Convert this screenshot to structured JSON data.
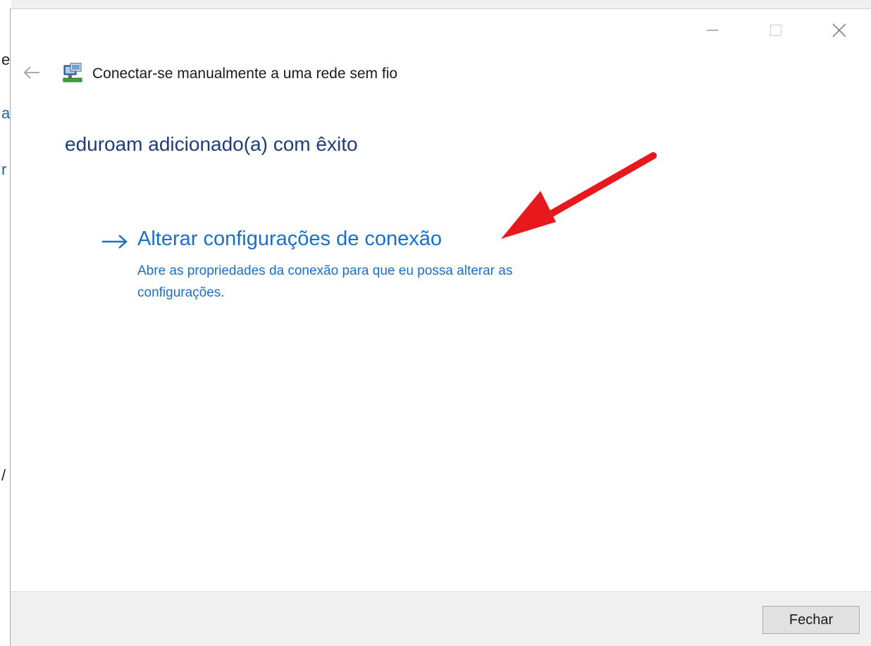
{
  "background_window": {
    "fragments": [
      "e",
      "a",
      "r",
      "/"
    ]
  },
  "window": {
    "caption_controls": {
      "minimize_icon": "minimize-icon",
      "maximize_icon": "maximize-icon",
      "close_icon": "close-icon"
    },
    "back_icon": "back-arrow-icon",
    "network_icon": "network-adapter-icon",
    "title": "Conectar-se manualmente a uma rede sem fio"
  },
  "main": {
    "success_heading": "eduroam adicionado(a) com êxito",
    "command_link": {
      "icon": "arrow-right-icon",
      "label": "Alterar configurações de conexão",
      "description": "Abre as propriedades da conexão para que eu possa alterar as configurações."
    },
    "annotation": {
      "icon": "red-annotation-arrow",
      "color": "#e8191c"
    }
  },
  "footer": {
    "close_button_label": "Fechar"
  },
  "colors": {
    "link_blue": "#1a6fc9",
    "heading_blue": "#1e3c78",
    "footer_gray": "#f0f0f0"
  }
}
